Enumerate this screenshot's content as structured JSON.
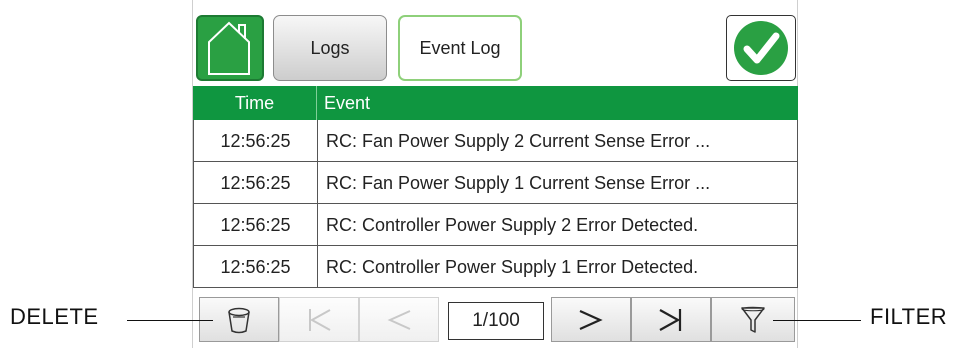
{
  "header": {
    "home_icon": "house-icon",
    "tabs": [
      {
        "label": "Logs",
        "active": false
      },
      {
        "label": "Event Log",
        "active": true
      }
    ],
    "ok_icon": "check-circle-icon"
  },
  "table": {
    "columns": [
      "Time",
      "Event"
    ],
    "rows": [
      {
        "time": "12:56:25",
        "event": "RC: Fan Power Supply 2 Current Sense Error ..."
      },
      {
        "time": "12:56:25",
        "event": "RC: Fan Power Supply 1 Current Sense Error ..."
      },
      {
        "time": "12:56:25",
        "event": "RC: Controller Power Supply 2 Error Detected."
      },
      {
        "time": "12:56:25",
        "event": "RC: Controller Power Supply 1 Error Detected."
      }
    ]
  },
  "toolbar": {
    "delete_icon": "trash-icon",
    "first_icon": "first-page-icon",
    "prev_icon": "previous-page-icon",
    "page_indicator": "1/100",
    "next_icon": "next-page-icon",
    "last_icon": "last-page-icon",
    "filter_icon": "filter-icon"
  },
  "callouts": {
    "delete": "DELETE",
    "filter": "FILTER"
  },
  "colors": {
    "accent_green": "#0f9640",
    "home_green": "#2aa043",
    "active_tab_border": "#8ed07a"
  }
}
